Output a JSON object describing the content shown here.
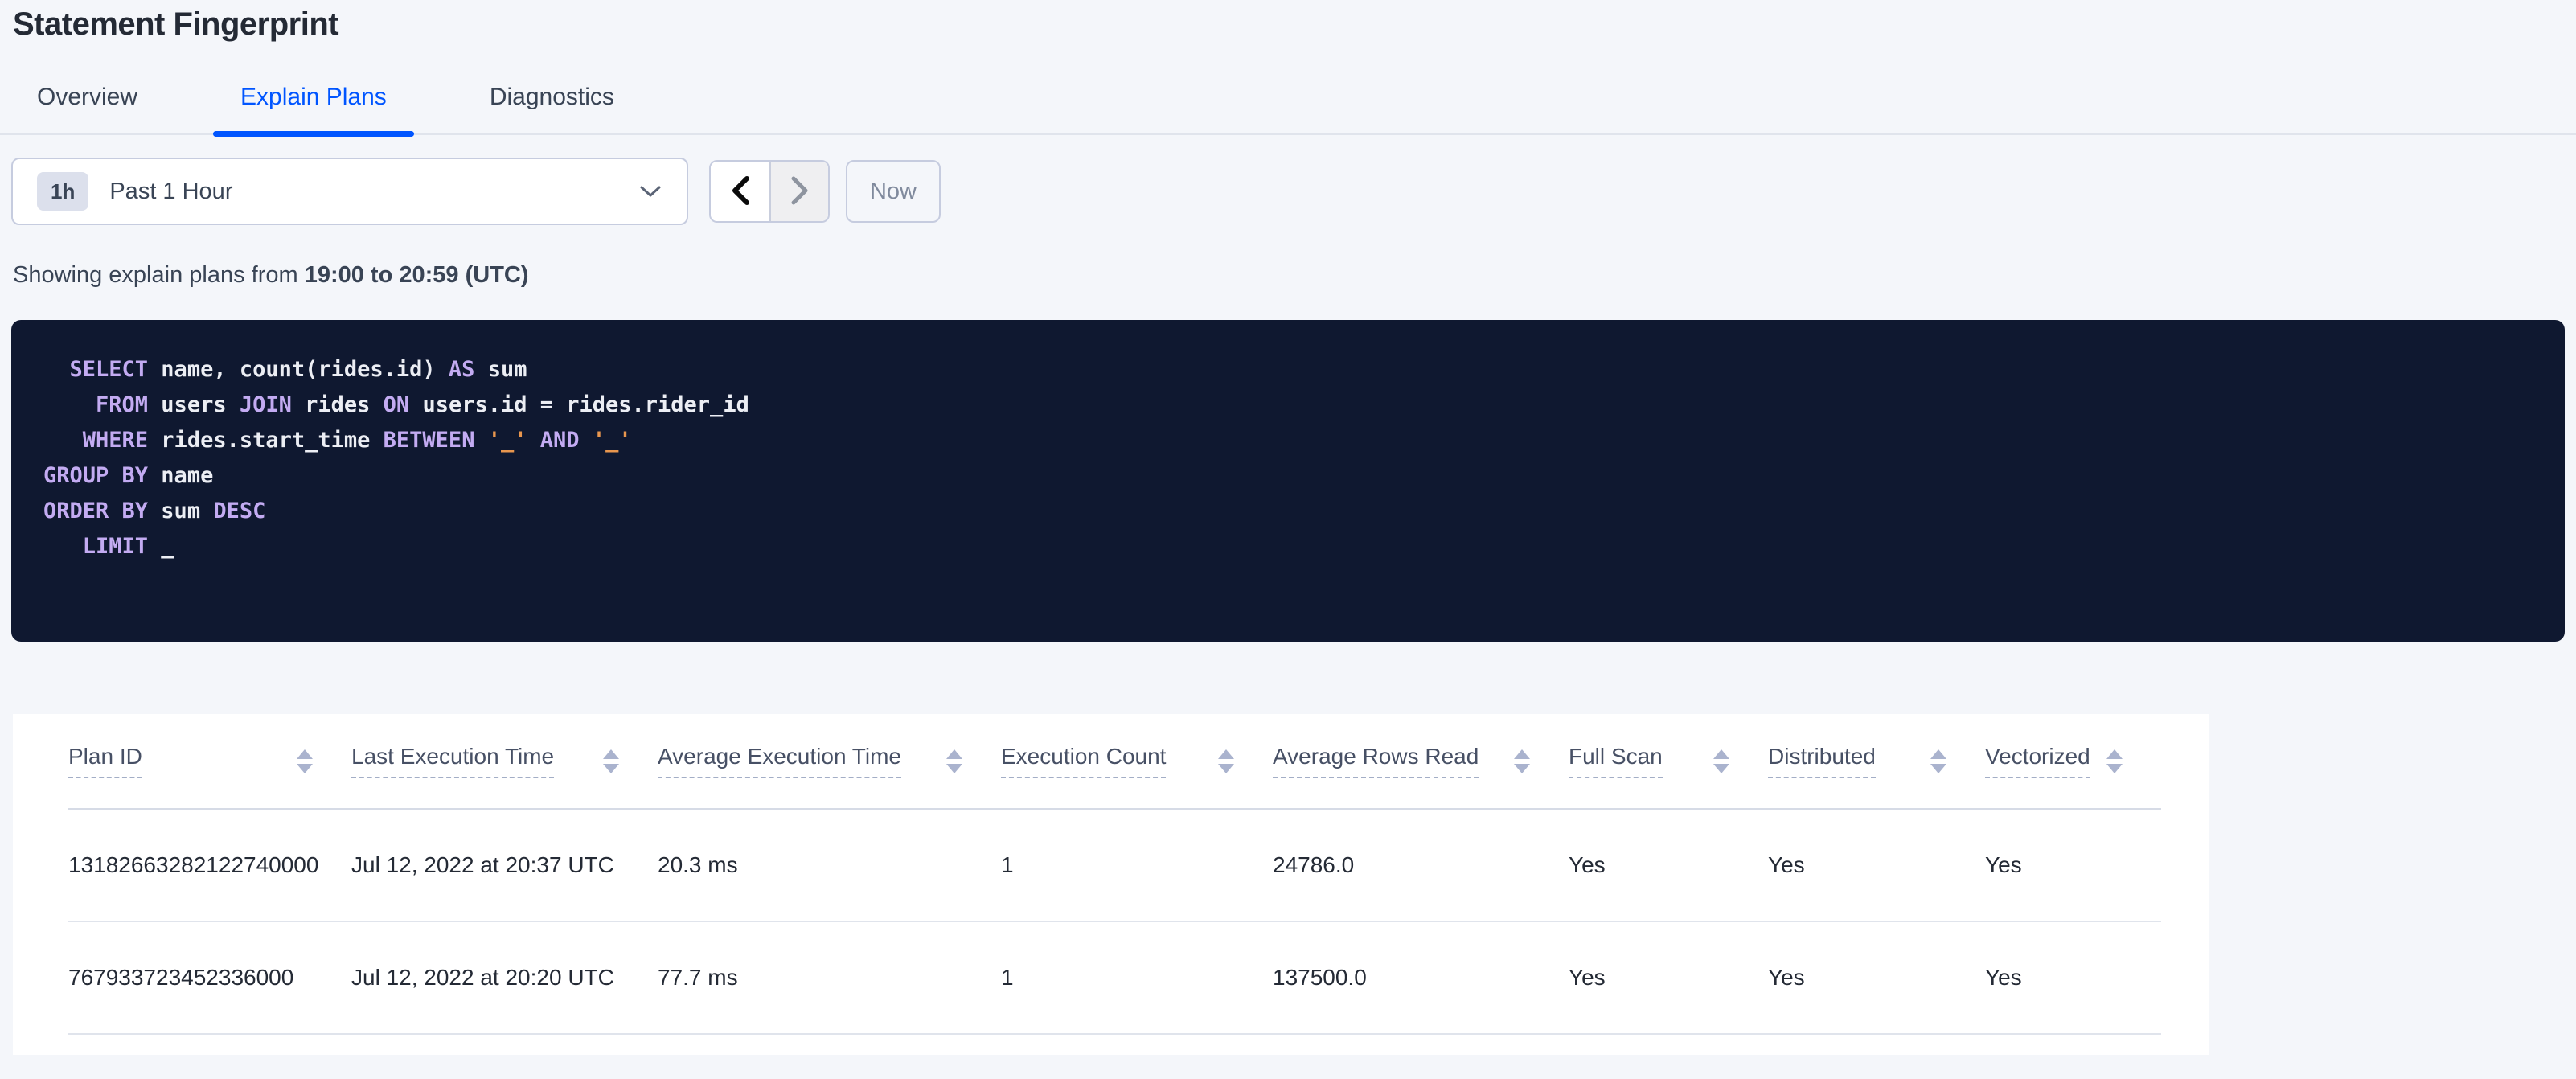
{
  "page": {
    "title": "Statement Fingerprint"
  },
  "tabs": {
    "items": [
      {
        "label": "Overview",
        "active": false
      },
      {
        "label": "Explain Plans",
        "active": true
      },
      {
        "label": "Diagnostics",
        "active": false
      }
    ]
  },
  "time_picker": {
    "range_badge": "1h",
    "range_label": "Past 1 Hour",
    "now_label": "Now"
  },
  "status_line": {
    "prefix": "Showing explain plans from ",
    "range": "19:00 to 20:59 (UTC)"
  },
  "sql_statement": {
    "lines": [
      [
        {
          "t": "kw",
          "v": "  SELECT"
        },
        {
          "t": "pl",
          "v": " name, count(rides.id) "
        },
        {
          "t": "kw",
          "v": "AS"
        },
        {
          "t": "pl",
          "v": " sum"
        }
      ],
      [
        {
          "t": "kw",
          "v": "    FROM"
        },
        {
          "t": "pl",
          "v": " users "
        },
        {
          "t": "kw",
          "v": "JOIN"
        },
        {
          "t": "pl",
          "v": " rides "
        },
        {
          "t": "kw",
          "v": "ON"
        },
        {
          "t": "pl",
          "v": " users.id = rides.rider_id"
        }
      ],
      [
        {
          "t": "kw",
          "v": "   WHERE"
        },
        {
          "t": "pl",
          "v": " rides.start_time "
        },
        {
          "t": "kw",
          "v": "BETWEEN"
        },
        {
          "t": "pl",
          "v": " "
        },
        {
          "t": "str",
          "v": "'_'"
        },
        {
          "t": "pl",
          "v": " "
        },
        {
          "t": "kw",
          "v": "AND"
        },
        {
          "t": "pl",
          "v": " "
        },
        {
          "t": "str",
          "v": "'_'"
        }
      ],
      [
        {
          "t": "kw",
          "v": "GROUP BY"
        },
        {
          "t": "pl",
          "v": " name"
        }
      ],
      [
        {
          "t": "kw",
          "v": "ORDER BY"
        },
        {
          "t": "pl",
          "v": " sum "
        },
        {
          "t": "kw",
          "v": "DESC"
        }
      ],
      [
        {
          "t": "kw",
          "v": "   LIMIT"
        },
        {
          "t": "pl",
          "v": " _"
        }
      ]
    ]
  },
  "table": {
    "columns": [
      {
        "label": "Plan ID"
      },
      {
        "label": "Last Execution Time"
      },
      {
        "label": "Average Execution Time"
      },
      {
        "label": "Execution Count"
      },
      {
        "label": "Average Rows Read"
      },
      {
        "label": "Full Scan"
      },
      {
        "label": "Distributed"
      },
      {
        "label": "Vectorized"
      }
    ],
    "rows": [
      [
        "13182663282122740000",
        "Jul 12, 2022 at 20:37 UTC",
        "20.3 ms",
        "1",
        "24786.0",
        "Yes",
        "Yes",
        "Yes"
      ],
      [
        "767933723452336000",
        "Jul 12, 2022 at 20:20 UTC",
        "77.7 ms",
        "1",
        "137500.0",
        "Yes",
        "Yes",
        "Yes"
      ]
    ]
  },
  "colors": {
    "accent_blue": "#0055ff",
    "page_background": "#f4f6fa",
    "sql_box_background": "#0f1830",
    "sql_keyword": "#c3abf2",
    "sql_literal": "#e8964e"
  },
  "icons": {
    "dropdown_caret": "chevron-down",
    "prev": "chevron-left",
    "next": "chevron-right",
    "sort": "sort-arrows"
  }
}
